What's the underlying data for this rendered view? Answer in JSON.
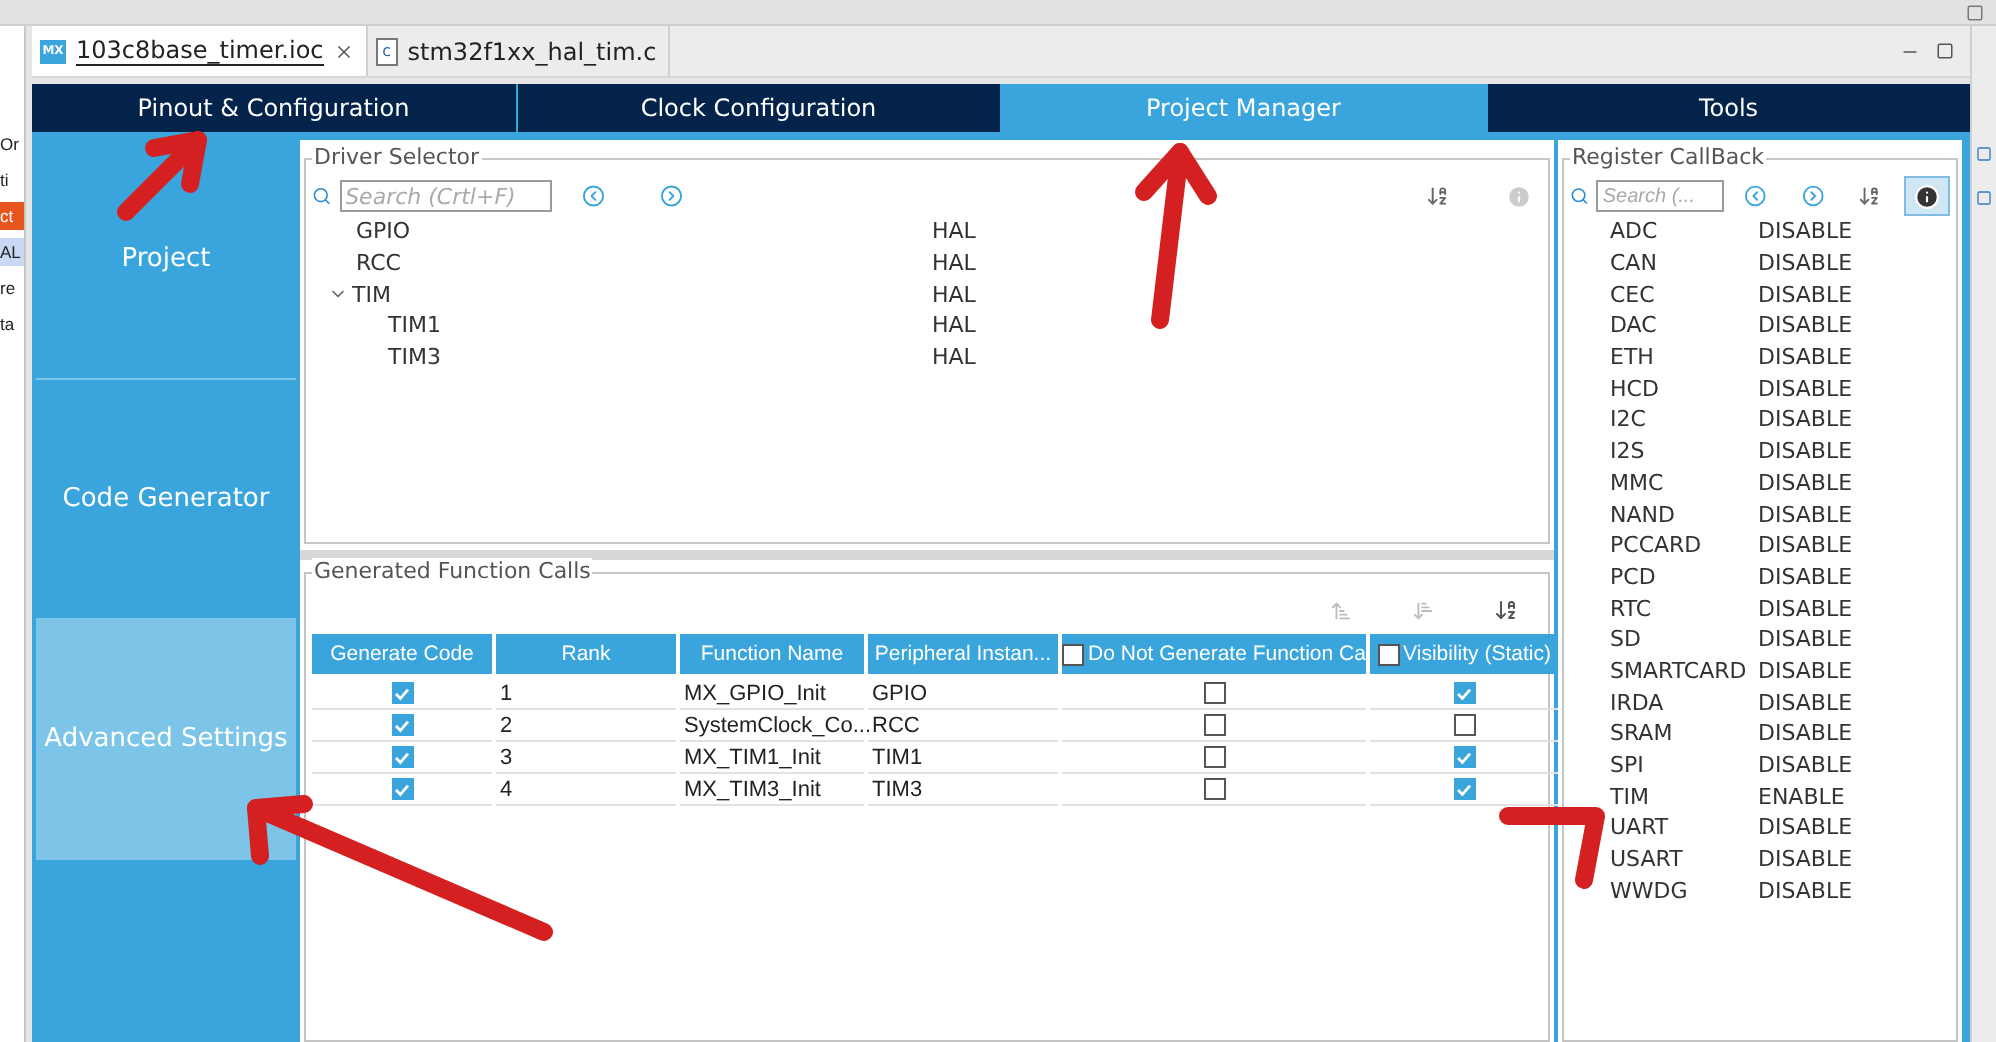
{
  "editor_tabs": [
    {
      "icon": "MX",
      "label": "103c8base_timer.ioc",
      "selected": true
    },
    {
      "icon": "c",
      "label": "stm32f1xx_hal_tim.c",
      "selected": false
    }
  ],
  "main_tabs": [
    {
      "label": "Pinout & Configuration",
      "selected": false
    },
    {
      "label": "Clock Configuration",
      "selected": false
    },
    {
      "label": "Project Manager",
      "selected": true
    },
    {
      "label": "Tools",
      "selected": false
    }
  ],
  "sidebar": [
    {
      "label": "Project",
      "selected": false
    },
    {
      "label": "Code Generator",
      "selected": false
    },
    {
      "label": "Advanced Settings",
      "selected": true
    }
  ],
  "left_fragments": [
    {
      "text": "Or",
      "kind": "plain"
    },
    {
      "text": "ti",
      "kind": "plain"
    },
    {
      "text": "ct",
      "kind": "highlight"
    },
    {
      "text": "AL",
      "kind": "selected"
    },
    {
      "text": "re",
      "kind": "plain"
    },
    {
      "text": "ta",
      "kind": "plain"
    }
  ],
  "driver_selector": {
    "title": "Driver Selector",
    "placeholder": "Search (Crtl+F)",
    "info_pressed": false,
    "rows": [
      {
        "name": "GPIO",
        "value": "HAL"
      },
      {
        "name": "RCC",
        "value": "HAL"
      },
      {
        "name": "TIM",
        "value": "HAL",
        "expanded": true,
        "children": [
          {
            "name": "TIM1",
            "value": "HAL"
          },
          {
            "name": "TIM3",
            "value": "HAL"
          }
        ]
      }
    ]
  },
  "function_calls": {
    "title": "Generated Function Calls",
    "columns": [
      {
        "label": "Generate Code",
        "kind": "text"
      },
      {
        "label": "Rank",
        "kind": "text"
      },
      {
        "label": "Function Name",
        "kind": "text"
      },
      {
        "label": "Peripheral Instan...",
        "kind": "text"
      },
      {
        "label": "Do Not Generate Function Ca",
        "kind": "checkbox",
        "checked": false
      },
      {
        "label": "Visibility (Static)",
        "kind": "checkbox",
        "checked": false
      }
    ],
    "rows": [
      {
        "generate": true,
        "rank": "1",
        "function": "MX_GPIO_Init",
        "peripheral": "GPIO",
        "skip": false,
        "visibility": true
      },
      {
        "generate": true,
        "rank": "2",
        "function": "SystemClock_Co...",
        "peripheral": "RCC",
        "skip": false,
        "visibility": false
      },
      {
        "generate": true,
        "rank": "3",
        "function": "MX_TIM1_Init",
        "peripheral": "TIM1",
        "skip": false,
        "visibility": true
      },
      {
        "generate": true,
        "rank": "4",
        "function": "MX_TIM3_Init",
        "peripheral": "TIM3",
        "skip": false,
        "visibility": true
      }
    ]
  },
  "register_callback": {
    "title": "Register CallBack",
    "placeholder": "Search (...",
    "info_pressed": true,
    "rows": [
      {
        "name": "ADC",
        "value": "DISABLE"
      },
      {
        "name": "CAN",
        "value": "DISABLE"
      },
      {
        "name": "CEC",
        "value": "DISABLE"
      },
      {
        "name": "DAC",
        "value": "DISABLE"
      },
      {
        "name": "ETH",
        "value": "DISABLE"
      },
      {
        "name": "HCD",
        "value": "DISABLE"
      },
      {
        "name": "I2C",
        "value": "DISABLE"
      },
      {
        "name": "I2S",
        "value": "DISABLE"
      },
      {
        "name": "MMC",
        "value": "DISABLE"
      },
      {
        "name": "NAND",
        "value": "DISABLE"
      },
      {
        "name": "PCCARD",
        "value": "DISABLE"
      },
      {
        "name": "PCD",
        "value": "DISABLE"
      },
      {
        "name": "RTC",
        "value": "DISABLE"
      },
      {
        "name": "SD",
        "value": "DISABLE"
      },
      {
        "name": "SMARTCARD",
        "value": "DISABLE"
      },
      {
        "name": "IRDA",
        "value": "DISABLE"
      },
      {
        "name": "SRAM",
        "value": "DISABLE"
      },
      {
        "name": "SPI",
        "value": "DISABLE"
      },
      {
        "name": "TIM",
        "value": "ENABLE"
      },
      {
        "name": "UART",
        "value": "DISABLE"
      },
      {
        "name": "USART",
        "value": "DISABLE"
      },
      {
        "name": "WWDG",
        "value": "DISABLE"
      }
    ]
  }
}
